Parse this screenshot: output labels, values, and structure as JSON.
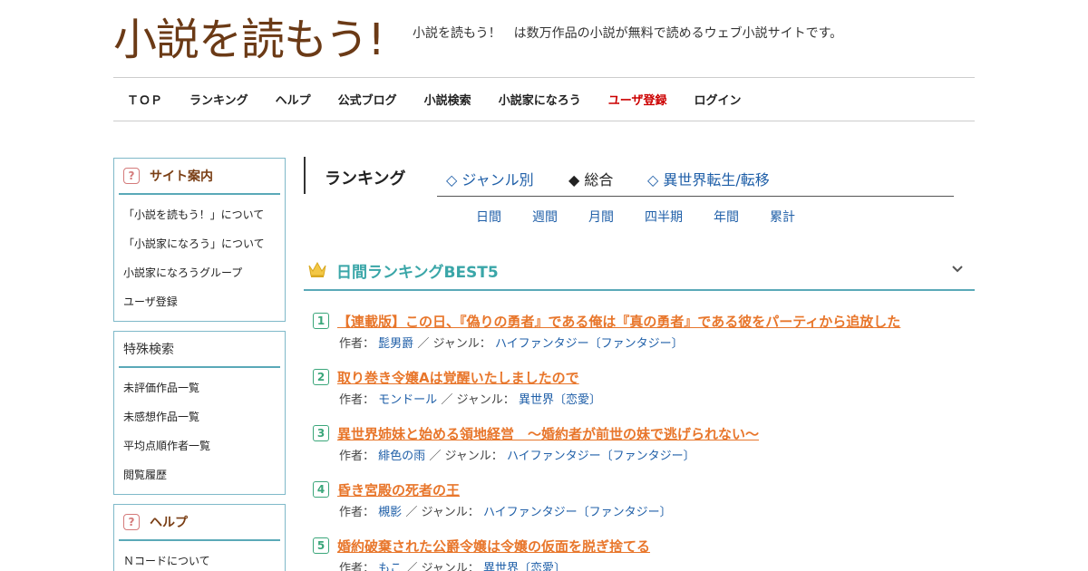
{
  "site": {
    "logo_text": "小説を読もう!",
    "tagline": "小説を読もう！　は数万作品の小説が無料で読めるウェブ小説サイトです。"
  },
  "nav": [
    {
      "label": "ＴＯＰ",
      "highlight": false
    },
    {
      "label": "ランキング",
      "highlight": false
    },
    {
      "label": "ヘルプ",
      "highlight": false
    },
    {
      "label": "公式ブログ",
      "highlight": false
    },
    {
      "label": "小説検索",
      "highlight": false
    },
    {
      "label": "小説家になろう",
      "highlight": false
    },
    {
      "label": "ユーザ登録",
      "highlight": true
    },
    {
      "label": "ログイン",
      "highlight": false
    }
  ],
  "sidebar": {
    "site_guide": {
      "title": "サイト案内",
      "items": [
        "「小説を読もう！」について",
        "「小説家になろう」について",
        "小説家になろうグループ",
        "ユーザ登録"
      ]
    },
    "special_search": {
      "title": "特殊検索",
      "items": [
        "未評価作品一覧",
        "未感想作品一覧",
        "平均点順作者一覧",
        "閲覧履歴"
      ]
    },
    "help": {
      "title": "ヘルプ",
      "items": [
        "Ｎコードについて"
      ]
    }
  },
  "ranking": {
    "title": "ランキング",
    "tabs": [
      {
        "label": "◇ ジャンル別",
        "active": false
      },
      {
        "label": "◆ 総合",
        "active": true
      },
      {
        "label": "◇ 異世界転生/転移",
        "active": false
      }
    ],
    "periods": [
      "日間",
      "週間",
      "月間",
      "四半期",
      "年間",
      "累計"
    ],
    "best_title": "日間ランキングBEST5",
    "author_label": "作者：",
    "genre_label": "／ ジャンル：",
    "items": [
      {
        "rank": "1",
        "title": "【連載版】この日、『偽りの勇者』である俺は『真の勇者』である彼をパーティから追放した",
        "author": "髭男爵",
        "genre": "ハイファンタジー〔ファンタジー〕"
      },
      {
        "rank": "2",
        "title": "取り巻き令嬢Aは覚醒いたしましたので",
        "author": "モンドール",
        "genre": "異世界〔恋愛〕"
      },
      {
        "rank": "3",
        "title": "異世界姉妹と始める領地経営　～婚約者が前世の妹で逃げられない～",
        "author": "緋色の雨",
        "genre": "ハイファンタジー〔ファンタジー〕"
      },
      {
        "rank": "4",
        "title": "昏き宮殿の死者の王",
        "author": "槻影",
        "genre": "ハイファンタジー〔ファンタジー〕"
      },
      {
        "rank": "5",
        "title": "婚約破棄された公爵令嬢は令嬢の仮面を脱ぎ捨てる",
        "author": "もこ",
        "genre": "異世界〔恋愛〕"
      }
    ]
  },
  "colors": {
    "accent_teal": "#5aa9b8",
    "title_orange": "#e8762b",
    "link_blue": "#1f5fa8",
    "logo_brown": "#6b3a16",
    "register_red": "#cc0000"
  }
}
